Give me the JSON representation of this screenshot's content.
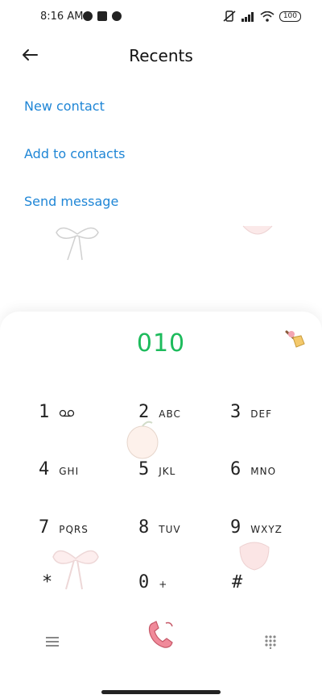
{
  "status": {
    "time": "8:16 AM",
    "battery": "100"
  },
  "header": {
    "title": "Recents"
  },
  "actions": [
    {
      "label": "New contact"
    },
    {
      "label": "Add to contacts"
    },
    {
      "label": "Send message"
    }
  ],
  "dialer": {
    "number": "010",
    "keys": [
      {
        "digit": "1",
        "letters": ""
      },
      {
        "digit": "2",
        "letters": "ABC"
      },
      {
        "digit": "3",
        "letters": "DEF"
      },
      {
        "digit": "4",
        "letters": "GHI"
      },
      {
        "digit": "5",
        "letters": "JKL"
      },
      {
        "digit": "6",
        "letters": "MNO"
      },
      {
        "digit": "7",
        "letters": "PQRS"
      },
      {
        "digit": "8",
        "letters": "TUV"
      },
      {
        "digit": "9",
        "letters": "WXYZ"
      },
      {
        "digit": "*",
        "letters": ""
      },
      {
        "digit": "0",
        "letters": "+"
      },
      {
        "digit": "#",
        "letters": ""
      }
    ]
  },
  "colors": {
    "accent": "#1f86d6",
    "number": "#1dbb5c",
    "call": "#f08a9a"
  },
  "icons": [
    "back-arrow-icon",
    "voicemail-icon",
    "broom-icon",
    "menu-icon",
    "call-icon",
    "dialpad-icon"
  ]
}
